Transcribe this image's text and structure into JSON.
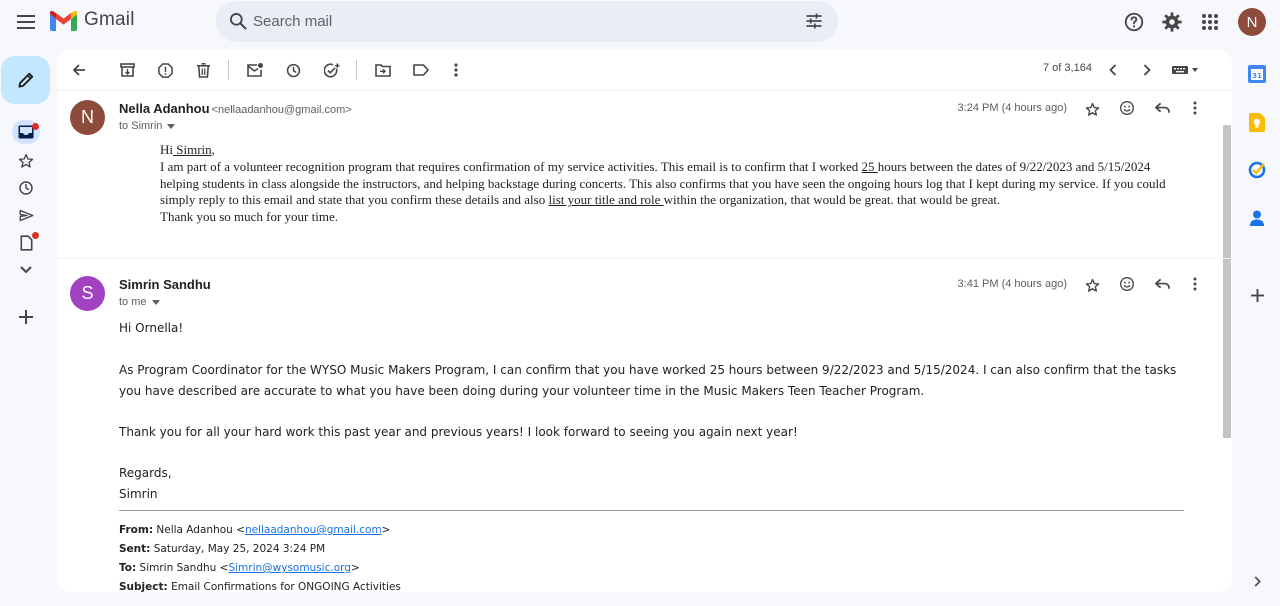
{
  "app": {
    "name": "Gmail",
    "account_initial": "N"
  },
  "search": {
    "placeholder": "Search mail"
  },
  "toolbar": {
    "pager": "7 of 3,164"
  },
  "messages": [
    {
      "avatar_initial": "N",
      "avatar_color": "#8d4b3c",
      "sender": "Nella Adanhou",
      "email": "<nellaadanhou@gmail.com>",
      "to": "to Simrin",
      "time": "3:24 PM (4 hours ago)",
      "greeting_prefix": "Hi",
      "greeting_name": " Simrin",
      "greeting_suffix": ",",
      "p1": "I am part of a volunteer recognition program that requires confirmation of my service activities. This email is to confirm that I worked ",
      "hours": "25 ",
      "p2": "hours between the dates of 9/22/2023 and 5/15/2024 helping students in class alongside the instructors, and helping backstage during concerts. This also confirms that you have seen the ongoing hours log that I kept during my service. If you could simply reply to this email and state that you confirm these details and also ",
      "link": "list your title and role ",
      "p3": "within the organization, that would be great. that would be great.",
      "closing": "Thank you so much for your time."
    },
    {
      "avatar_initial": "S",
      "avatar_color": "#a142c1",
      "sender": "Simrin Sandhu",
      "to": "to me",
      "time": "3:41 PM (4 hours ago)",
      "greeting": "Hi Ornella!",
      "para1": "As Program Coordinator for the WYSO Music Makers Program, I can confirm that you have worked 25 hours between 9/22/2023 and 5/15/2024. I can also confirm that the tasks you have described are accurate to what you have been doing during your volunteer time in the Music Makers Teen Teacher Program.",
      "para2": "Thank you for all your hard work this past year and previous years! I look forward to seeing you again next year!",
      "regards": "Regards,",
      "signature": "Simrin"
    }
  ],
  "quoted": {
    "from_label": "From:",
    "from_name": "Nella Adanhou <",
    "from_email": "nellaadanhou@gmail.com",
    "from_end": ">",
    "sent_label": "Sent:",
    "sent_value": "Saturday, May 25, 2024 3:24 PM",
    "to_label": "To:",
    "to_name": "Simrin Sandhu <",
    "to_email": "Simrin@wysomusic.org",
    "to_end": ">",
    "subject_label": "Subject:",
    "subject_value": "Email Confirmations for ONGOING Activities"
  },
  "colors": {
    "compose_bg": "#c2e7ff",
    "search_bg": "#e9eef6",
    "page_bg": "#f6f8fc",
    "link": "#1a73e8",
    "badge": "#d93025"
  }
}
